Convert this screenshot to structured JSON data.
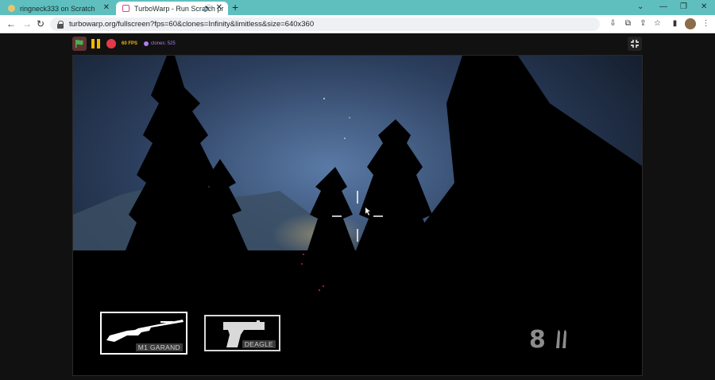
{
  "browser": {
    "tabs": [
      {
        "label": "ringneck333 on Scratch",
        "active": false
      },
      {
        "label": "TurboWarp - Run Scratch pr",
        "active": true
      }
    ],
    "url": "turbowarp.org/fullscreen?fps=60&clones=Infinity&limitless&size=640x360"
  },
  "player": {
    "fps_label": "60 FPS",
    "clones_label": "clones: 525"
  },
  "game": {
    "weapons": [
      {
        "name": "M1 GARAND",
        "selected": true,
        "icon": "rifle-icon"
      },
      {
        "name": "DEAGLE",
        "selected": false,
        "icon": "pistol-icon"
      }
    ],
    "ammo_count": "8"
  },
  "colors": {
    "tabstrip": "#5fbfbf",
    "fps": "#f5b400",
    "clones": "#b07cf0",
    "stop": "#e23a48",
    "flag": "#4caf50"
  }
}
